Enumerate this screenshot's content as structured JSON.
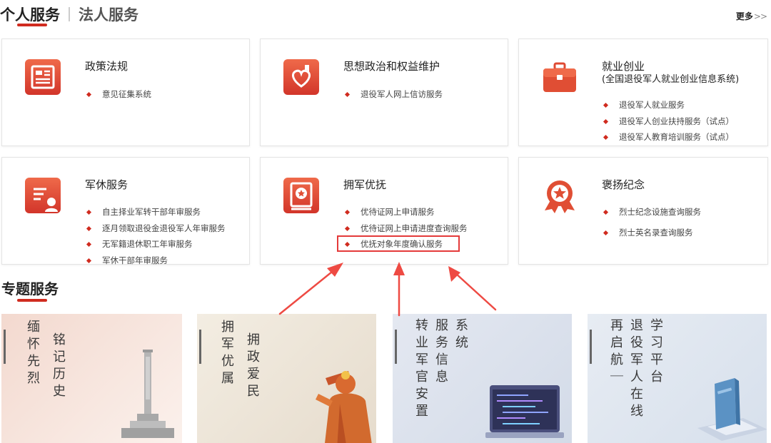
{
  "header": {
    "tab_personal": "个人服务",
    "tab_legal": "法人服务",
    "more_label": "更多",
    "more_arrows": ">>"
  },
  "cards": [
    {
      "title": "政策法规",
      "icon": "document-icon",
      "items": [
        "意见征集系统"
      ]
    },
    {
      "title": "思想政治和权益维护",
      "icon": "heart-bookmark-icon",
      "items": [
        "退役军人网上信访服务"
      ]
    },
    {
      "title": "就业创业",
      "subtitle": "(全国退役军人就业创业信息系统)",
      "icon": "briefcase-icon",
      "items": [
        "退役军人就业服务",
        "退役军人创业扶持服务（试点）",
        "退役军人教育培训服务（试点）"
      ]
    },
    {
      "title": "军休服务",
      "icon": "certificate-user-icon",
      "items": [
        "自主择业军转干部年审服务",
        "逐月领取退役金退役军人年审服务",
        "无军籍退休职工年审服务",
        "军休干部年审服务"
      ]
    },
    {
      "title": "拥军优抚",
      "icon": "star-book-icon",
      "items": [
        "优待证网上申请服务",
        "优待证网上申请进度查询服务",
        "优抚对象年度确认服务"
      ]
    },
    {
      "title": "褒扬纪念",
      "icon": "medal-star-icon",
      "items": [
        "烈士纪念设施查询服务",
        "烈士英名录查询服务"
      ]
    }
  ],
  "section": {
    "title": "专题服务"
  },
  "tiles": [
    {
      "col1": "缅怀先烈",
      "col2": "铭记历史"
    },
    {
      "col1": "拥军优属",
      "col2": "拥政爱民"
    },
    {
      "col1": "转业军官安置",
      "col2": "服务信息",
      "col3": "系统"
    },
    {
      "col1": "再启航｜",
      "col2": "退役军人在线",
      "col3": "学习平台"
    }
  ],
  "colors": {
    "accent": "#d02b1f",
    "highlight": "#e43a3a"
  }
}
